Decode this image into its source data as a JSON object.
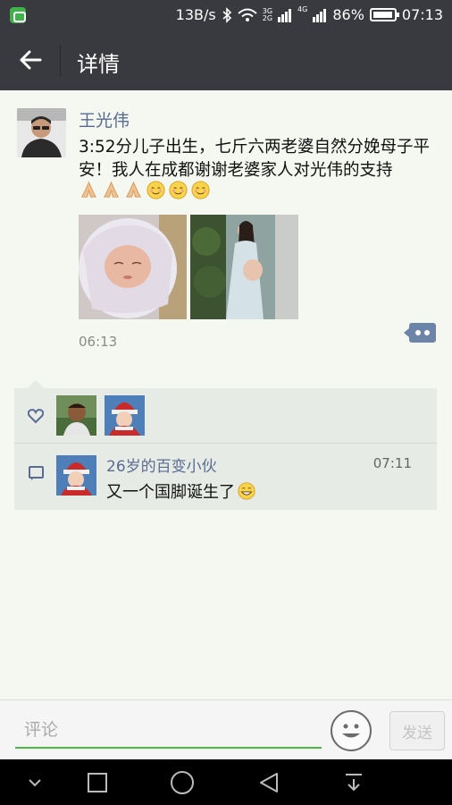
{
  "status_bar": {
    "speed": "13B/s",
    "net_top": "3G",
    "net_bottom": "2G",
    "net_4g": "4G",
    "battery": "86%",
    "time": "07:13"
  },
  "header": {
    "title": "详情"
  },
  "post": {
    "author": "王光伟",
    "text": "3:52分儿子出生，七斤六两老婆自然分娩母子平安！我人在成都谢谢老婆家人对光伟的支持",
    "emojis": [
      "pray-icon",
      "pray-icon",
      "pray-icon",
      "blush-icon",
      "blush-icon",
      "blush-icon"
    ],
    "photos": [
      "newborn-baby-photo",
      "pregnant-woman-photo"
    ],
    "time": "06:13"
  },
  "likes": {
    "avatars": [
      "liker-avatar-1",
      "liker-avatar-2"
    ]
  },
  "comments": [
    {
      "name": "26岁的百变小伙",
      "time": "07:11",
      "text": "又一个国脚诞生了"
    }
  ],
  "input": {
    "placeholder": "评论",
    "send_label": "发送"
  },
  "colors": {
    "bar": "#393a3f",
    "accent": "#4cb944",
    "link": "#5a6b93"
  }
}
